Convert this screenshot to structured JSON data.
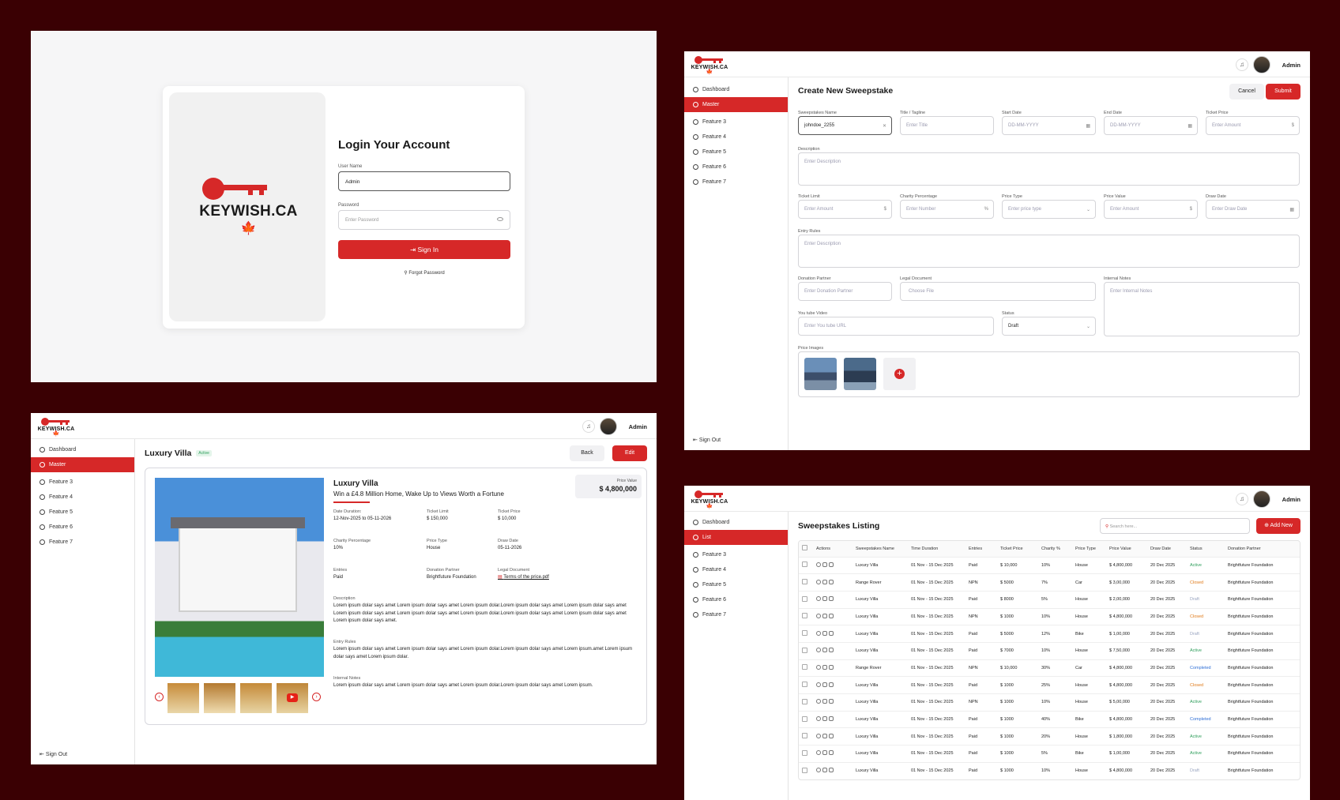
{
  "brand": {
    "name": "KEYWISH.CA",
    "short": "KEYWISH.CA",
    "leaf": "🍁",
    "admin": "Admin"
  },
  "login": {
    "title": "Login Your Account",
    "user_label": "User Name",
    "user_value": "Admin",
    "pass_label": "Password",
    "pass_placeholder": "Enter Password",
    "signin": "Sign In",
    "forgot": "Forgot Password"
  },
  "create": {
    "title": "Create New Sweepstake",
    "cancel": "Cancel",
    "submit": "Submit",
    "nav": [
      "Dashboard",
      "Master",
      "Feature 3",
      "Feature 4",
      "Feature 5",
      "Feature 6",
      "Feature 7"
    ],
    "signout": "Sign Out",
    "f_name_l": "Sweepstakes Name",
    "f_name_v": "johndoe_2255",
    "f_title_l": "Title / Tagline",
    "f_title_p": "Enter Title",
    "f_start_l": "Start Date",
    "f_start_p": "DD-MM-YYYY",
    "f_end_l": "End Date",
    "f_end_p": "DD-MM-YYYY",
    "f_tp_l": "Ticket Price",
    "f_tp_p": "Enter Amount",
    "dollar": "$",
    "pct": "%",
    "f_desc_l": "Description",
    "f_desc_p": "Enter Description",
    "f_tl_l": "Ticket Limit",
    "f_tl_p": "Enter Amount",
    "f_cp_l": "Charity Percentage",
    "f_cp_p": "Enter Number",
    "f_pt_l": "Price Type",
    "f_pt_p": "Enter price type",
    "f_pv_l": "Price Value",
    "f_pv_p": "Enter Amount",
    "f_dd_l": "Draw Date",
    "f_dd_p": "Enter Draw Date",
    "f_er_l": "Entry Rules",
    "f_er_p": "Enter Description",
    "f_dp_l": "Donation Partner",
    "f_dp_p": "Enter Donation Partner",
    "f_ld_l": "Legal Document",
    "f_ld_p": "Choose File",
    "f_in_l": "Internal Notes",
    "f_in_p": "Enter Internal Notes",
    "f_yt_l": "You tube Video",
    "f_yt_p": "Enter You tube URL",
    "f_st_l": "Status",
    "f_st_v": "Draft",
    "f_pi_l": "Price Images"
  },
  "detail": {
    "title": "Luxury Villa",
    "badge": "Active",
    "back": "Back",
    "edit": "Edit",
    "nav": [
      "Dashboard",
      "Master",
      "Feature 3",
      "Feature 4",
      "Feature 5",
      "Feature 6",
      "Feature 7"
    ],
    "signout": "Sign Out",
    "name": "Luxury Villa",
    "tagline": "Win a £4.8 Million Home, Wake Up to Views Worth a Fortune",
    "pv_label": "Price Value",
    "pv_value": "$ 4,800,000",
    "dur_l": "Date Duration:",
    "dur_v": "12-Nov-2025 to 05-11-2026",
    "tl_l": "Ticket Limit",
    "tl_v": "$ 150,000",
    "tp_l": "Ticket Price",
    "tp_v": "$ 10,000",
    "cp_l": "Charity Percentage",
    "cp_v": "10%",
    "pt_l": "Price Type",
    "pt_v": "House",
    "dd_l": "Draw Date",
    "dd_v": "05-11-2026",
    "en_l": "Entries",
    "en_v": "Paid",
    "dp_l": "Donation Partner",
    "dp_v": "Brightfuture Foundation",
    "ld_l": "Legal Document",
    "ld_v": "Terms of the price.pdf",
    "desc_l": "Description",
    "desc_v": "Lorem ipsum dolar says amet  Lorem ipsum dolar says amet Lorem ipsum dolar.Lorem ipsum dolar says amet Lorem ipsum dolar says amet Lorem ipsum dolar says amet  Lorem ipsum dolar says amet Lorem ipsum dolar.Lorem ipsum dolar says amet Lorem ipsum dolar says amet Lorem ipsum dolar says amet.",
    "er_l": "Entry Rules",
    "er_v": "Lorem ipsum dolar says amet  Lorem ipsum dolar says amet Lorem ipsum dolar.Lorem ipsum dolar says amet Lorem ipsum.amet  Lorem ipsum dolar says amet Lorem ipsum dolar.",
    "in_l": "Internal Notes",
    "in_v": "Lorem ipsum dolar says amet  Lorem ipsum dolar says amet Lorem ipsum dolar.Lorem ipsum dolar says amet Lorem ipsum."
  },
  "listing": {
    "title": "Sweepstakes Listing",
    "search_p": "Search here...",
    "add": "Add New",
    "nav": [
      "Dashboard",
      "List",
      "Feature 3",
      "Feature 4",
      "Feature 5",
      "Feature 6",
      "Feature 7"
    ],
    "cols": [
      "Actions",
      "Sweepstakes Name",
      "Time Duration",
      "Entries",
      "Ticket Price",
      "Charity %",
      "Price Type",
      "Price Value",
      "Draw Date",
      "Status",
      "Donation Partner"
    ],
    "rows": [
      [
        "Luxury Villa",
        "01 Nov - 15 Dec 2025",
        "Paid",
        "$ 10,000",
        "10%",
        "House",
        "$ 4,800,000",
        "20 Dec 2025",
        "Active",
        "Brightfuture Foundation"
      ],
      [
        "Range Rover",
        "01 Nov - 15 Dec 2025",
        "NPN",
        "$ 5000",
        "7%",
        "Car",
        "$ 3,00,000",
        "20 Dec 2025",
        "Closed",
        "Brightfuture Foundation"
      ],
      [
        "Luxury Villa",
        "01 Nov - 15 Dec 2025",
        "Paid",
        "$ 8000",
        "5%",
        "House",
        "$ 2,00,000",
        "20 Dec 2025",
        "Draft",
        "Brightfuture Foundation"
      ],
      [
        "Luxury Villa",
        "01 Nov - 15 Dec 2025",
        "NPN",
        "$ 1000",
        "10%",
        "House",
        "$ 4,800,000",
        "20 Dec 2025",
        "Closed",
        "Brightfuture Foundation"
      ],
      [
        "Luxury Villa",
        "01 Nov - 15 Dec 2025",
        "Paid",
        "$ 5000",
        "12%",
        "Bike",
        "$ 1,00,000",
        "20 Dec 2025",
        "Draft",
        "Brightfuture Foundation"
      ],
      [
        "Luxury Villa",
        "01 Nov - 15 Dec 2025",
        "Paid",
        "$ 7000",
        "10%",
        "House",
        "$ 7,50,000",
        "20 Dec 2025",
        "Active",
        "Brightfuture Foundation"
      ],
      [
        "Range Rover",
        "01 Nov - 15 Dec 2025",
        "NPN",
        "$ 10,000",
        "30%",
        "Car",
        "$ 4,800,000",
        "20 Dec 2025",
        "Completed",
        "Brightfuture Foundation"
      ],
      [
        "Luxury Villa",
        "01 Nov - 15 Dec 2025",
        "Paid",
        "$ 1000",
        "25%",
        "House",
        "$ 4,800,000",
        "20 Dec 2025",
        "Closed",
        "Brightfuture Foundation"
      ],
      [
        "Luxury Villa",
        "01 Nov - 15 Dec 2025",
        "NPN",
        "$ 1000",
        "10%",
        "House",
        "$ 5,00,000",
        "20 Dec 2025",
        "Active",
        "Brightfuture Foundation"
      ],
      [
        "Luxury Villa",
        "01 Nov - 15 Dec 2025",
        "Paid",
        "$ 1000",
        "40%",
        "Bike",
        "$ 4,800,000",
        "20 Dec 2025",
        "Completed",
        "Brightfuture Foundation"
      ],
      [
        "Luxury Villa",
        "01 Nov - 15 Dec 2025",
        "Paid",
        "$ 1000",
        "20%",
        "House",
        "$ 1,800,000",
        "20 Dec 2025",
        "Active",
        "Brightfuture Foundation"
      ],
      [
        "Luxury Villa",
        "01 Nov - 15 Dec 2025",
        "Paid",
        "$ 1000",
        "5%",
        "Bike",
        "$ 1,00,000",
        "20 Dec 2025",
        "Active",
        "Brightfuture Foundation"
      ],
      [
        "Luxury Villa",
        "01 Nov - 15 Dec 2025",
        "Paid",
        "$ 1000",
        "10%",
        "House",
        "$ 4,800,000",
        "20 Dec 2025",
        "Draft",
        "Brightfuture Foundation"
      ]
    ]
  },
  "colors": {
    "accent": "#d62828",
    "bg": "#3a0003",
    "active": "#2e9e5b",
    "closed": "#e07b1a",
    "draft": "#9aa5c0",
    "completed": "#2f6fd6"
  }
}
